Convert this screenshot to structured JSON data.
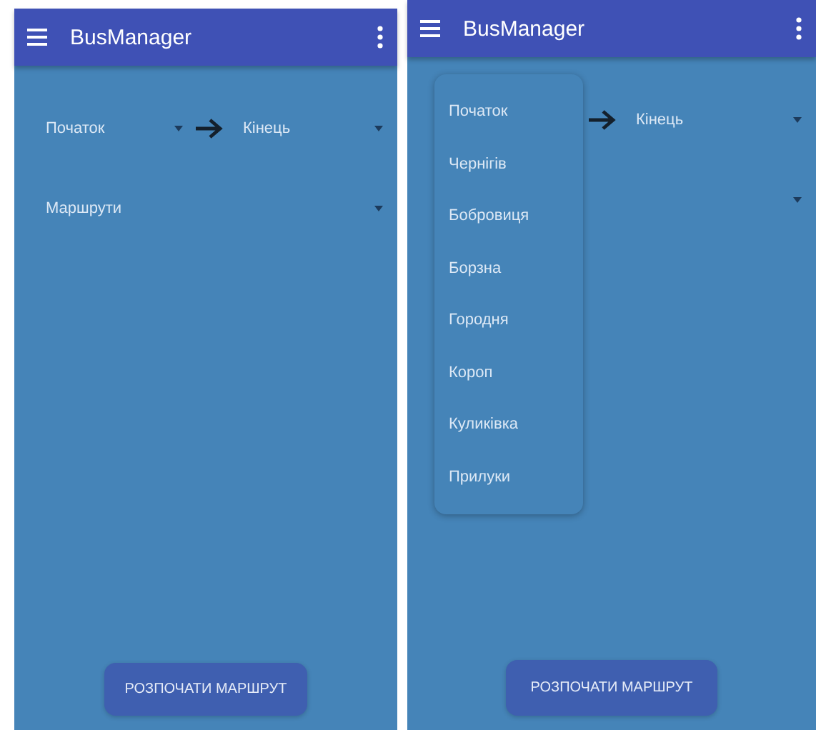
{
  "screens": [
    {
      "app_bar": {
        "title": "BusManager"
      },
      "from_spinner": {
        "value": "Початок"
      },
      "to_spinner": {
        "value": "Кінець"
      },
      "routes_spinner": {
        "value": "Маршрути"
      },
      "button": "РОЗПОЧАТИ МАРШРУТ"
    },
    {
      "app_bar": {
        "title": "BusManager"
      },
      "to_spinner": {
        "value": "Кінець"
      },
      "dropdown": {
        "items": [
          "Початок",
          "Чернігів",
          "Бобровиця",
          "Борзна",
          "Городня",
          "Короп",
          "Куликівка",
          "Прилуки"
        ]
      },
      "button": "РОЗПОЧАТИ МАРШРУТ"
    }
  ]
}
